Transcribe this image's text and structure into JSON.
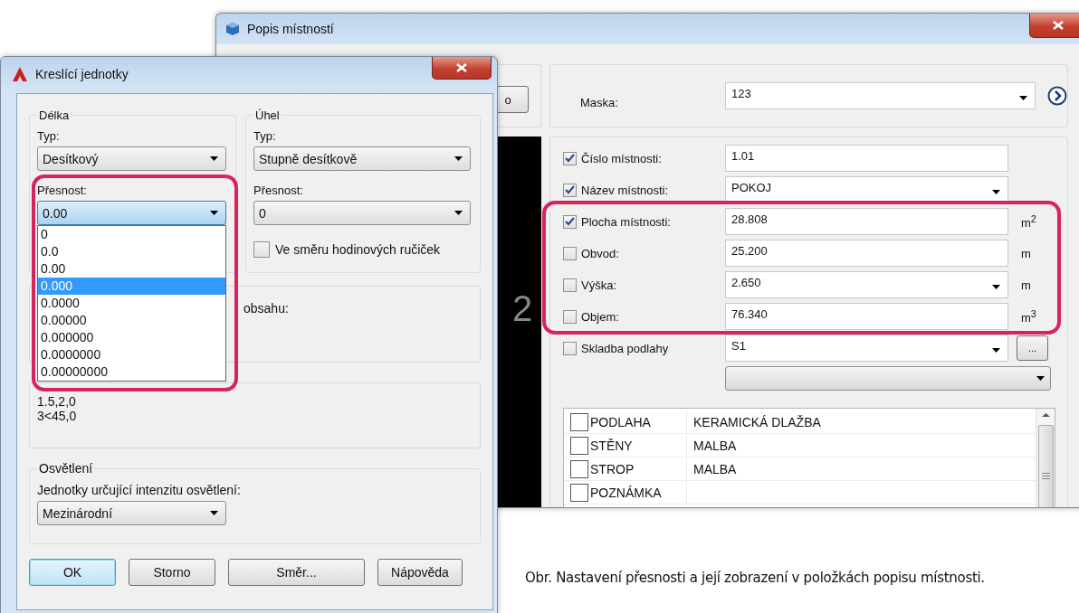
{
  "room_dialog": {
    "title": "Popis místností",
    "partial_button": "o",
    "preview_text": "2",
    "mask": {
      "label": "Maska:",
      "value": "123"
    },
    "fields": [
      {
        "kind": "text",
        "label": "Číslo místnosti:",
        "checked": true,
        "value": "1.01"
      },
      {
        "kind": "combo",
        "label": "Název místnosti:",
        "checked": true,
        "value": "POKOJ"
      },
      {
        "kind": "text",
        "label": "Plocha místnosti:",
        "checked": true,
        "value": "28.808",
        "unit": "m$^{2}$"
      },
      {
        "kind": "text",
        "label": "Obvod:",
        "checked": false,
        "value": "25.200",
        "unit": "m"
      },
      {
        "kind": "combo",
        "label": "Výška:",
        "checked": false,
        "value": "2.650",
        "unit": "m"
      },
      {
        "kind": "text",
        "label": "Objem:",
        "checked": false,
        "value": "76.340",
        "unit": "m$^{3}$"
      }
    ],
    "floor": {
      "label": "Skladba podlahy",
      "checked": false,
      "value": "S1",
      "button": "..."
    },
    "table": {
      "rows": [
        {
          "checked": false,
          "name": "PODLAHA",
          "value": "KERAMICKÁ DLAŽBA"
        },
        {
          "checked": false,
          "name": "STĚNY",
          "value": "MALBA"
        },
        {
          "checked": false,
          "name": "STROP",
          "value": "MALBA"
        },
        {
          "checked": false,
          "name": "POZNÁMKA"
        }
      ]
    }
  },
  "units_dialog": {
    "title": "Kreslící jednotky",
    "length": {
      "title": "Délka",
      "type_label": "Typ:",
      "type_value": "Desítkový",
      "precision_label": "Přesnost:",
      "precision_value": "0.00",
      "precision_options": [
        {
          "label": "0",
          "selected": false
        },
        {
          "label": "0.0",
          "selected": false
        },
        {
          "label": "0.00",
          "selected": false
        },
        {
          "label": "0.000",
          "selected": true
        },
        {
          "label": "0.0000",
          "selected": false
        },
        {
          "label": "0.00000",
          "selected": false
        },
        {
          "label": "0.000000",
          "selected": false
        },
        {
          "label": "0.0000000",
          "selected": false
        },
        {
          "label": "0.00000000",
          "selected": false
        }
      ]
    },
    "angle": {
      "title": "Úhel",
      "type_label": "Typ:",
      "type_value": "Stupně desítkově",
      "precision_label": "Přesnost:",
      "precision_value": "0",
      "clockwise": {
        "label": "Ve směru hodinových ručiček",
        "checked": false
      }
    },
    "insertion_label": "obsahu:",
    "sample": [
      "1.5,2,0",
      "3<45,0"
    ],
    "lighting": {
      "title": "Osvětlení",
      "label": "Jednotky určující intenzitu osvětlení:",
      "value": "Mezinárodní"
    },
    "buttons": [
      {
        "label": "OK",
        "default": true
      },
      {
        "label": "Storno",
        "default": false
      },
      {
        "label": "Směr...",
        "default": false
      },
      {
        "label": "Nápověda",
        "default": false
      }
    ]
  },
  "caption": "Obr. Nastavení přesnosti a její zobrazení v položkách popisu místnosti."
}
